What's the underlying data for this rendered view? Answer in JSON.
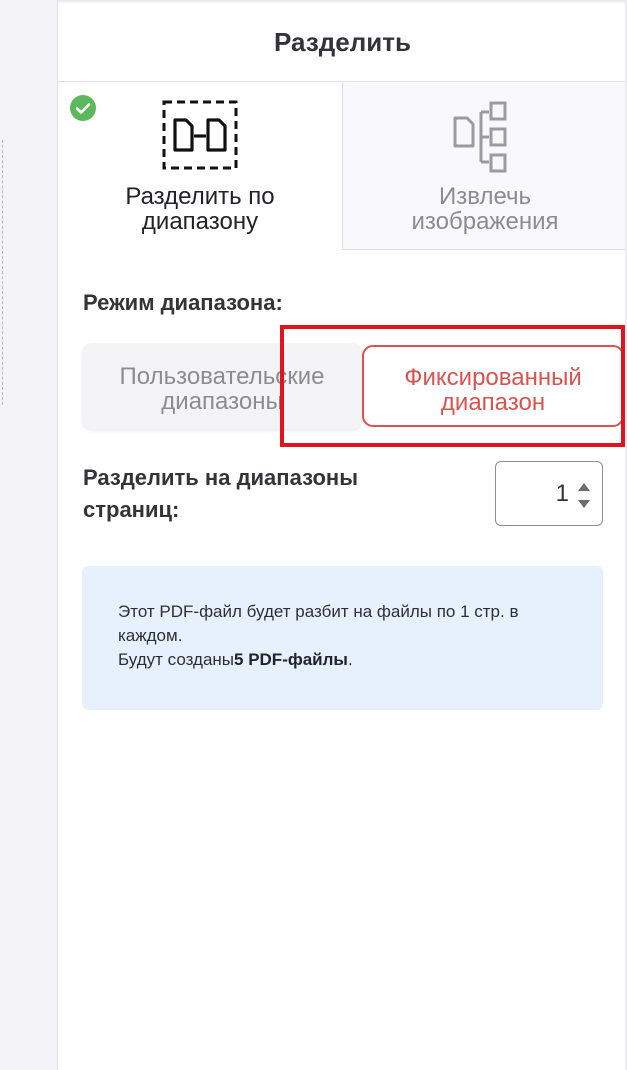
{
  "panel": {
    "title": "Разделить"
  },
  "tabs": {
    "split": {
      "label_line1": "Разделить по",
      "label_line2": "диапазону",
      "selected": true,
      "icon": "split-document-icon"
    },
    "extract": {
      "label_line1": "Извлечь",
      "label_line2": "изображения",
      "icon": "extract-pages-icon"
    }
  },
  "range_mode": {
    "label": "Режим диапазона:",
    "custom_line1": "Пользовательские",
    "custom_line2": "диапазоны",
    "fixed_line1": "Фиксированный",
    "fixed_line2": "диапазон",
    "selected": "fixed"
  },
  "split_pages": {
    "label_line1": "Разделить на диапазоны",
    "label_line2": "страниц:",
    "value": "1"
  },
  "info": {
    "line1": "Этот PDF-файл будет разбит на файлы по 1 стр. в",
    "line2": "каждом.",
    "line3_prefix": "Будут созданы",
    "line3_bold": "5 PDF-файлы",
    "line3_suffix": "."
  },
  "colors": {
    "accent_red": "#d9534f",
    "highlight_red": "#e0131f",
    "check_green": "#5cb85c",
    "info_bg": "#e6f1fd"
  }
}
